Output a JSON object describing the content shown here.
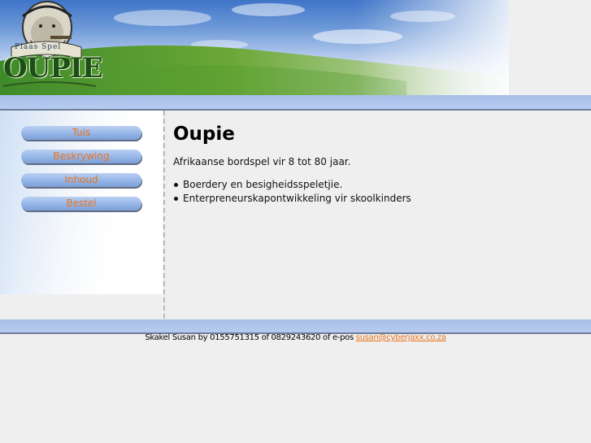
{
  "header": {
    "logo_text": "OUPIE",
    "logo_subtitle": "Plaas Spel"
  },
  "nav": {
    "items": [
      {
        "label": "Tuis"
      },
      {
        "label": "Beskrywing"
      },
      {
        "label": "Inhoud"
      },
      {
        "label": "Bestel"
      }
    ]
  },
  "main": {
    "title": "Oupie",
    "intro": "Afrikaanse bordspel vir 8 tot 80 jaar.",
    "bullets": [
      "Boerdery en besigheidsspeletjie.",
      "Enterpreneurskapontwikkeling vir skoolkinders"
    ]
  },
  "footer": {
    "text": "Skakel Susan by 0155751315 of 0829243620 of e-pos ",
    "email": "susan@cyberjaxx.co.za"
  },
  "colors": {
    "accent": "#e8731f",
    "nav_button": "#92b3e6",
    "bar": "#b0c6ee"
  }
}
